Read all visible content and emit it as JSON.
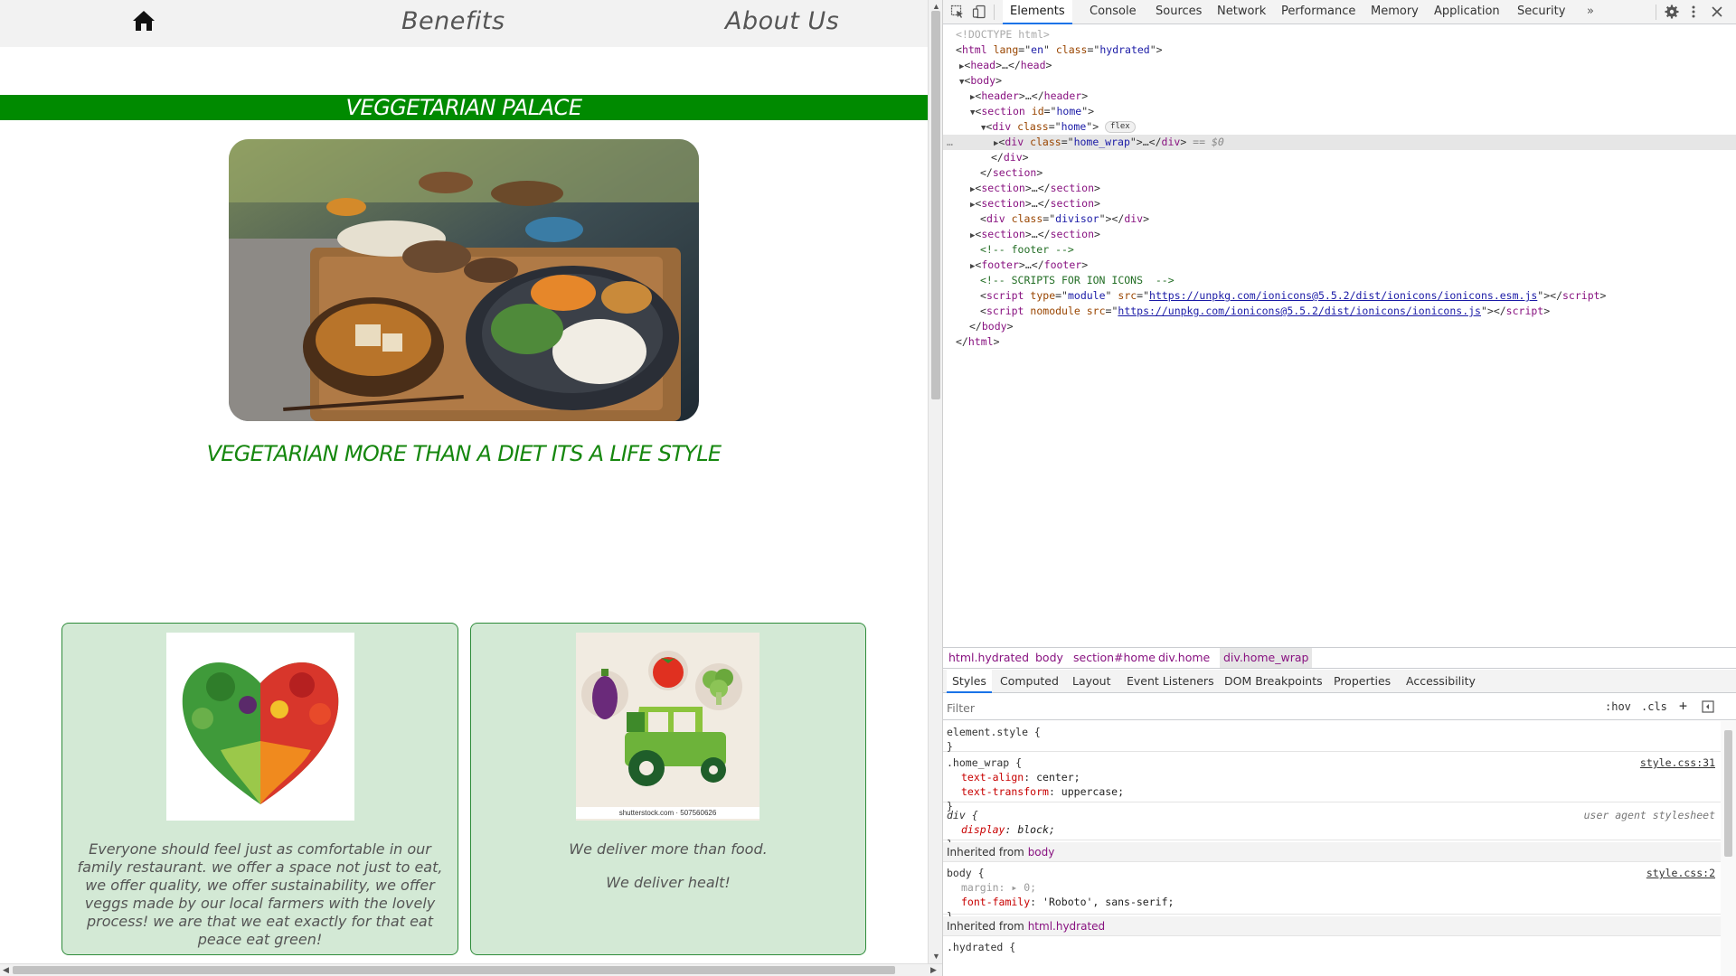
{
  "site": {
    "nav": {
      "benefits": "Benefits",
      "about": "About Us"
    },
    "brand": "VEGGETARIAN PALACE",
    "tagline": "VEGETARIAN MORE THAN A DIET ITS A LIFE STYLE",
    "cards": [
      {
        "text": "Everyone should feel just as comfortable in our family restaurant. we offer a space not just to eat, we offer quality, we offer sustainability, we offer veggs made by our local farmers with the lovely process! we are that we eat exactly for that eat peace eat green!"
      },
      {
        "line1": "We deliver more than food.",
        "line2": "We deliver healt!",
        "image_caption": "shutterstock.com · 507560626"
      }
    ]
  },
  "devtools": {
    "tabs": [
      "Elements",
      "Console",
      "Sources",
      "Network",
      "Performance",
      "Memory",
      "Application",
      "Security"
    ],
    "more": "»",
    "dom": {
      "doctype": "<!DOCTYPE html>",
      "html_open_tag": "html",
      "html_lang_attr": "lang",
      "html_lang_val": "en",
      "html_class_attr": "class",
      "html_class_val": "hydrated",
      "head": "head",
      "head_ellipsis": "…",
      "body": "body",
      "header": "header",
      "section": "section",
      "section_id_attr": "id",
      "section_id_val": "home",
      "div": "div",
      "div_class_attr": "class",
      "div_home_val": "home",
      "flex_badge": "flex",
      "home_wrap_val": "home_wrap",
      "selected_marker": "== $0",
      "divisor_val": "divisor",
      "comment_footer": "<!-- footer -->",
      "footer": "footer",
      "comment_scripts": "<!-- SCRIPTS FOR ION ICONS  -->",
      "script": "script",
      "type_attr": "type",
      "type_val": "module",
      "src_attr": "src",
      "src1": "https://unpkg.com/ionicons@5.5.2/dist/ionicons/ionicons.esm.js",
      "nomodule_attr": "nomodule",
      "src2": "https://unpkg.com/ionicons@5.5.2/dist/ionicons/ionicons.js",
      "dots": "…"
    },
    "breadcrumbs": [
      "html.hydrated",
      "body",
      "section#home",
      "div.home",
      "div.home_wrap"
    ],
    "subtabs": [
      "Styles",
      "Computed",
      "Layout",
      "Event Listeners",
      "DOM Breakpoints",
      "Properties",
      "Accessibility"
    ],
    "filter_placeholder": "Filter",
    "filter_hov": ":hov",
    "filter_cls": ".cls",
    "filter_plus": "+",
    "styles": {
      "element_style": "element.style {",
      "close": "}",
      "home_wrap_sel": ".home_wrap {",
      "home_wrap_src": "style.css:31",
      "ta_prop": "text-align",
      "ta_val": "center;",
      "tt_prop": "text-transform",
      "tt_val": "uppercase;",
      "div_sel": "div {",
      "div_src": "user agent stylesheet",
      "display_prop": "display",
      "display_val": "block;",
      "inherited_label": "Inherited from",
      "inherited_body": "body",
      "body_sel": "body {",
      "body_src": "style.css:2",
      "margin_prop": "margin",
      "margin_val": "0;",
      "ff_prop": "font-family",
      "ff_val": "'Roboto', sans-serif;",
      "inherited_html": "html.hydrated",
      "hydrated_sel": ".hydrated {"
    }
  }
}
